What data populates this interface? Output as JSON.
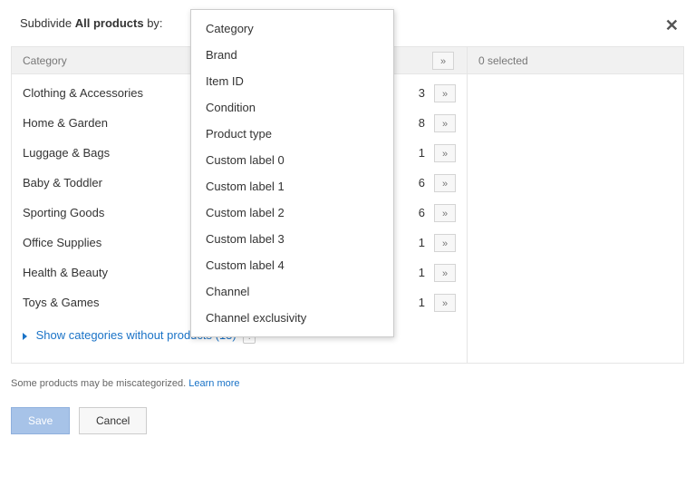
{
  "header": {
    "prefix": "Subdivide",
    "target": "All products",
    "suffix": "by:"
  },
  "close_glyph": "✕",
  "dropdown": {
    "items": [
      "Category",
      "Brand",
      "Item ID",
      "Condition",
      "Product type",
      "Custom label 0",
      "Custom label 1",
      "Custom label 2",
      "Custom label 3",
      "Custom label 4",
      "Channel",
      "Channel exclusivity"
    ]
  },
  "left_panel": {
    "header": "Category",
    "header_arrow": "»",
    "rows": [
      {
        "label": "Clothing & Accessories",
        "count": "3"
      },
      {
        "label": "Home & Garden",
        "count": "8"
      },
      {
        "label": "Luggage & Bags",
        "count": "1"
      },
      {
        "label": "Baby & Toddler",
        "count": "6"
      },
      {
        "label": "Sporting Goods",
        "count": "6"
      },
      {
        "label": "Office Supplies",
        "count": "1"
      },
      {
        "label": "Health & Beauty",
        "count": "1"
      },
      {
        "label": "Toys & Games",
        "count": "1"
      }
    ],
    "arrow_glyph": "»",
    "expand_text": "Show categories without products (13)",
    "help_glyph": "?"
  },
  "right_panel": {
    "header": "0 selected"
  },
  "footnote": {
    "text": "Some products may be miscategorized.",
    "link": "Learn more"
  },
  "buttons": {
    "save": "Save",
    "cancel": "Cancel"
  }
}
